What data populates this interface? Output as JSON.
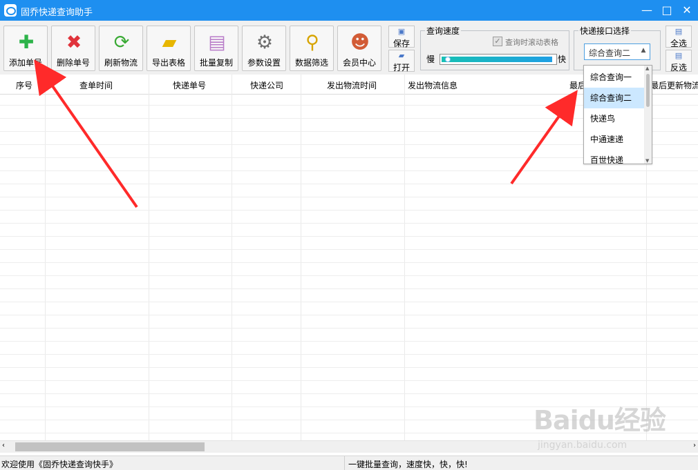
{
  "window": {
    "title": "固乔快递查询助手",
    "minimize": "—",
    "maximize": "□",
    "close": "✕"
  },
  "toolbar": {
    "buttons": [
      {
        "label": "添加单号",
        "icon": "add-icon",
        "glyph": "✚",
        "color": "#2db34a"
      },
      {
        "label": "删除单号",
        "icon": "delete-icon",
        "glyph": "✖",
        "color": "#e0333b"
      },
      {
        "label": "刷新物流",
        "icon": "refresh-icon",
        "glyph": "⟳",
        "color": "#3aaa35"
      },
      {
        "label": "导出表格",
        "icon": "folder-export-icon",
        "glyph": "▰",
        "color": "#e7b600"
      },
      {
        "label": "批量复制",
        "icon": "copy-documents-icon",
        "glyph": "▤",
        "color": "#b87bc8"
      },
      {
        "label": "参数设置",
        "icon": "gear-icon",
        "glyph": "⚙",
        "color": "#6d6d6d"
      },
      {
        "label": "数据筛选",
        "icon": "magnifier-filter-icon",
        "glyph": "⚲",
        "color": "#d7a400"
      },
      {
        "label": "会员中心",
        "icon": "members-icon",
        "glyph": "☻",
        "color": "#d25c36"
      }
    ],
    "save_label": "保存",
    "open_label": "打开",
    "select_all_label": "全选",
    "invert_label": "反选"
  },
  "speed": {
    "group_title": "查询速度",
    "scroll_label": "查询时滚动表格",
    "scroll_checked": true,
    "slow": "慢",
    "fast": "快",
    "level": 0.02
  },
  "api": {
    "group_title": "快递接口选择",
    "selected": "综合查询二",
    "options": [
      "综合查询一",
      "综合查询二",
      "快递鸟",
      "中通速递",
      "百世快递"
    ],
    "selected_index": 1
  },
  "table": {
    "columns": [
      "序号",
      "查单时间",
      "快递单号",
      "快递公司",
      "发出物流时间",
      "发出物流信息",
      "最后",
      "最后更新物流"
    ]
  },
  "status": {
    "left": "欢迎使用《固乔快递查询快手》",
    "right": "一键批量查询，速度快，快，快!"
  },
  "watermark": {
    "logo": "Baidu经验",
    "url": "jingyan.baidu.com"
  },
  "colors": {
    "title_bar": "#1e8ff0",
    "selection": "#cce8ff",
    "arrow": "#ff2a2a",
    "progress_start": "#17c0b4",
    "progress_end": "#1f9fe4"
  }
}
